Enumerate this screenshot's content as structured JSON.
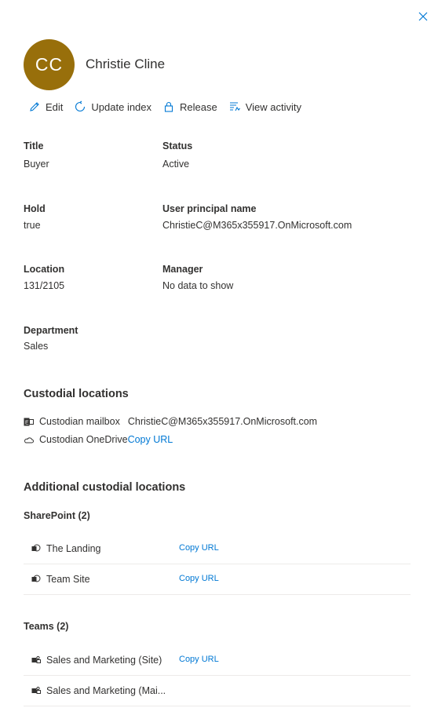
{
  "person": {
    "initials": "CC",
    "name": "Christie Cline"
  },
  "colors": {
    "avatar_bg": "#986f0b",
    "link": "#0078d4"
  },
  "toolbar": {
    "edit_label": "Edit",
    "update_index_label": "Update index",
    "release_label": "Release",
    "view_activity_label": "View activity"
  },
  "fields": {
    "title": {
      "label": "Title",
      "value": "Buyer"
    },
    "status": {
      "label": "Status",
      "value": "Active"
    },
    "hold": {
      "label": "Hold",
      "value": "true"
    },
    "upn": {
      "label": "User principal name",
      "value": "ChristieC@M365x355917.OnMicrosoft.com"
    },
    "location": {
      "label": "Location",
      "value": "131/2105"
    },
    "manager": {
      "label": "Manager",
      "value": "No data to show"
    },
    "department": {
      "label": "Department",
      "value": "Sales"
    }
  },
  "custodial": {
    "title": "Custodial locations",
    "mailbox_label": "Custodian mailbox",
    "mailbox_value": "ChristieC@M365x355917.OnMicrosoft.com",
    "onedrive_label": "Custodian OneDrive",
    "onedrive_link": "Copy URL"
  },
  "additional": {
    "title": "Additional custodial locations",
    "sharepoint_title": "SharePoint (2)",
    "sharepoint_items": [
      {
        "name": "The Landing",
        "link": "Copy URL"
      },
      {
        "name": "Team Site",
        "link": "Copy URL"
      }
    ],
    "teams_title": "Teams (2)",
    "teams_items": [
      {
        "name": "Sales and Marketing (Site)",
        "link": "Copy URL"
      },
      {
        "name": "Sales and Marketing (Mai...",
        "link": ""
      }
    ]
  }
}
